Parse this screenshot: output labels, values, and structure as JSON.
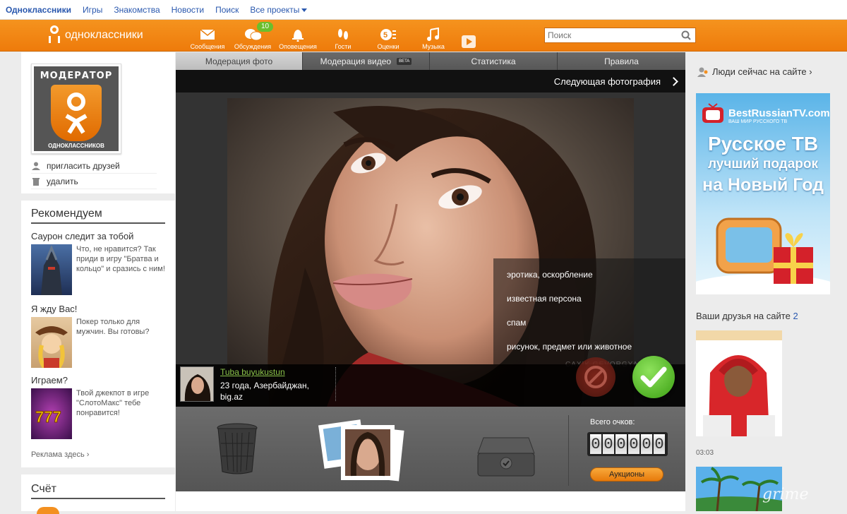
{
  "toplinks": {
    "brand": "Одноклассники",
    "games": "Игры",
    "dating": "Знакомства",
    "news": "Новости",
    "search": "Поиск",
    "all_projects": "Все проекты"
  },
  "header": {
    "logo_text": "одноклассники",
    "nav": [
      {
        "label": "Сообщения",
        "icon": "envelope-icon"
      },
      {
        "label": "Обсуждения",
        "icon": "discussion-icon",
        "badge": "10"
      },
      {
        "label": "Оповещения",
        "icon": "bell-icon"
      },
      {
        "label": "Гости",
        "icon": "footprints-icon"
      },
      {
        "label": "Оценки",
        "icon": "rating-icon"
      },
      {
        "label": "Музыка",
        "icon": "music-icon"
      }
    ],
    "search_placeholder": "Поиск"
  },
  "left": {
    "avatar_title": "МОДЕРАТОР",
    "avatar_sub": "ОДНОКЛАССНИКОВ",
    "invite_friends": "пригласить друзей",
    "delete": "удалить",
    "recommend_title": "Рекомендуем",
    "recommendations": [
      {
        "title": "Саурон следит за тобой",
        "desc": "Что, не нравится? Так приди в игру \"Братва и кольцо\" и сразись с ним!"
      },
      {
        "title": "Я жду Вас!",
        "desc": "Покер только для мужчин. Вы готовы?"
      },
      {
        "title": "Играем?",
        "desc": "Твой джекпот в игре \"СлотоМакс\" тебе понравится!"
      }
    ],
    "ad_link": "Реклама здесь ›",
    "account_title": "Счёт"
  },
  "center": {
    "tabs": [
      "Модерация фото",
      "Модерация видео",
      "Статистика",
      "Правила"
    ],
    "beta": "BETA",
    "next_photo": "Следующая фотография",
    "reasons": [
      "эротика, оскорбление",
      "известная персона",
      "спам",
      "рисунок, предмет или животное"
    ],
    "watermark": "CAXIK GEVORGYAN",
    "user_name": "Tuba buyukustun",
    "user_info_line1": "23 года, Азербайджан,",
    "user_info_line2": "big.az",
    "score_label": "Всего очков:",
    "score_digits": [
      "0",
      "0",
      "0",
      "0",
      "0",
      "0"
    ],
    "auction_button": "Аукционы"
  },
  "right": {
    "people_online": "Люди сейчас на сайте ›",
    "ad_brand": "BestRussianTV.com",
    "ad_sub": "ВАШ МИР РУССКОГО ТВ",
    "ad_line1": "Русское ТВ",
    "ad_line2": "лучший подарок",
    "ad_line3": "на Новый Год",
    "friends_label": "Ваши друзья на сайте",
    "friends_count": "2",
    "friend_time": "03:03",
    "site_watermark": "grime"
  },
  "colors": {
    "header_orange": "#f39020",
    "link_blue": "#2a58ae",
    "approve_green": "#4cb81e",
    "badge_green": "#6bbf2d"
  }
}
